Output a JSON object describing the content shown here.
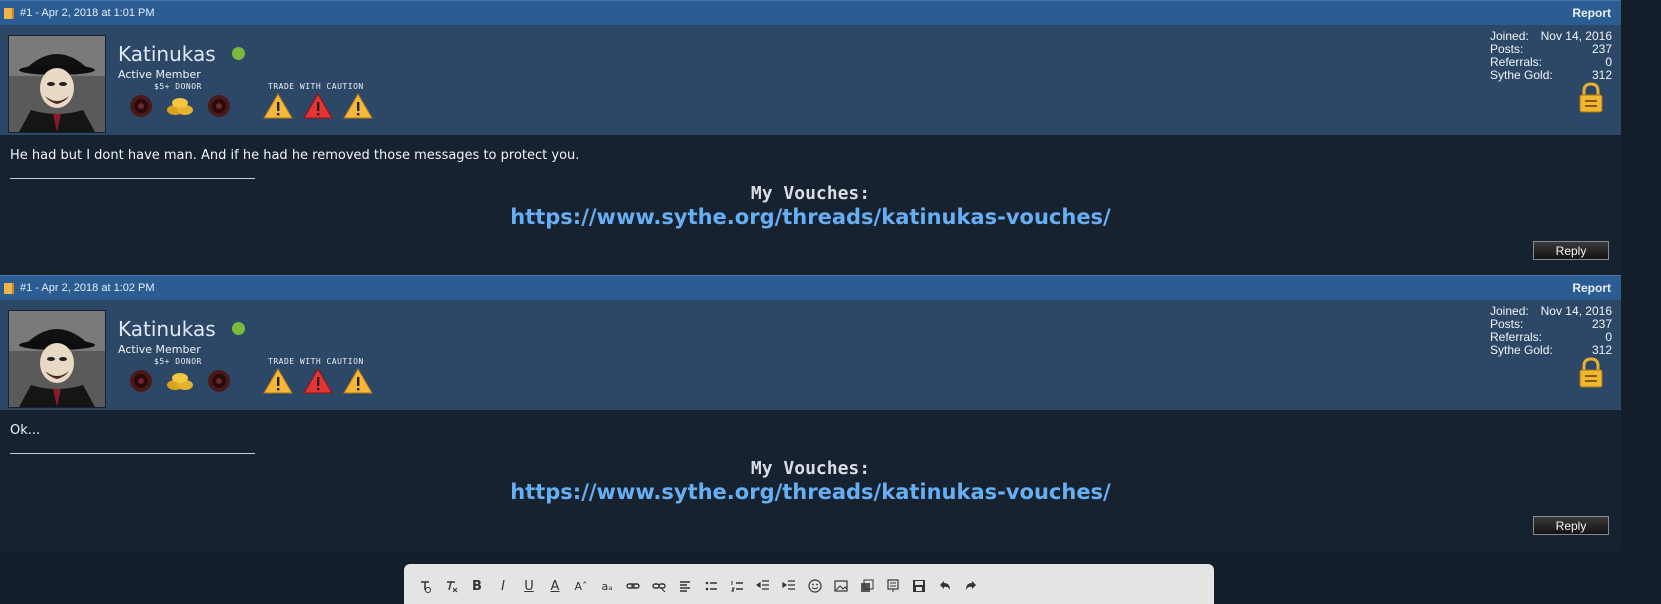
{
  "posts": [
    {
      "header": "#1 - Apr 2, 2018 at 1:01 PM",
      "report": "Report",
      "username": "Katinukas",
      "usertitle": "Active Member",
      "donor_label": "$5+ DONOR",
      "trade_label": "TRADE WITH CAUTION",
      "stats": [
        {
          "label": "Joined:",
          "value": "Nov 14, 2016"
        },
        {
          "label": "Posts:",
          "value": "237"
        },
        {
          "label": "Referrals:",
          "value": "0"
        },
        {
          "label": "Sythe Gold:",
          "value": "312"
        }
      ],
      "message": "He had but I dont have man. And if he had he removed those messages to protect you.",
      "sig_title": "My Vouches:",
      "sig_link": "https://www.sythe.org/threads/katinukas-vouches/",
      "reply": "Reply"
    },
    {
      "header": "#1 - Apr 2, 2018 at 1:02 PM",
      "report": "Report",
      "username": "Katinukas",
      "usertitle": "Active Member",
      "donor_label": "$5+ DONOR",
      "trade_label": "TRADE WITH CAUTION",
      "stats": [
        {
          "label": "Joined:",
          "value": "Nov 14, 2016"
        },
        {
          "label": "Posts:",
          "value": "237"
        },
        {
          "label": "Referrals:",
          "value": "0"
        },
        {
          "label": "Sythe Gold:",
          "value": "312"
        }
      ],
      "message": "Ok...",
      "sig_title": "My Vouches:",
      "sig_link": "https://www.sythe.org/threads/katinukas-vouches/",
      "reply": "Reply"
    }
  ],
  "colors": {
    "header_bg": "#2b5d93",
    "userbar_bg": "#2d4866",
    "body_bg": "#16222f",
    "link": "#68aef2",
    "online": "#7ab93e"
  },
  "editor_toolbar": [
    "remove-format-icon",
    "clear-format-icon",
    "bold-icon",
    "italic-icon",
    "underline-icon",
    "font-color-icon",
    "font-size-icon",
    "font-family-icon",
    "link-icon",
    "unlink-icon",
    "align-icon",
    "bullet-list-icon",
    "number-list-icon",
    "outdent-icon",
    "indent-icon",
    "smiley-icon",
    "image-icon",
    "media-icon",
    "code-icon",
    "save-icon",
    "undo-icon",
    "redo-icon"
  ],
  "editor_toolbar_glyphs": {
    "bold": "B",
    "italic": "I",
    "underline": "U",
    "font_color": "A",
    "font_size": "Aˆ",
    "font_family": "aₐ"
  }
}
